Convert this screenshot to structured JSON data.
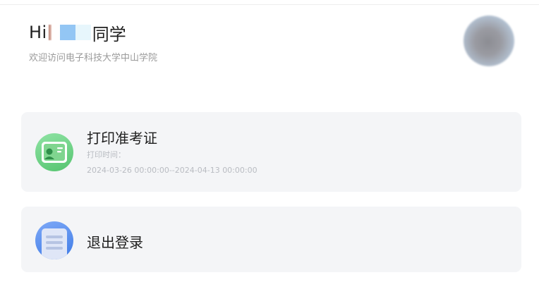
{
  "header": {
    "greeting_prefix": "Hi",
    "greeting_suffix": "同学",
    "welcome_text": "欢迎访问电子科技大学中山学院"
  },
  "cards": [
    {
      "title": "打印准考证",
      "time_label": "打印时间：",
      "time_range": "2024-03-26 00:00:00--2024-04-13 00:00:00",
      "icon": "id-card-icon",
      "icon_color": "#55c46f"
    },
    {
      "title": "退出登录",
      "icon": "document-icon",
      "icon_color": "#3d7ae6"
    }
  ],
  "colors": {
    "card_background": "#f4f5f7",
    "muted_text": "#9a9a9a",
    "primary_text": "#1f1f1f"
  }
}
